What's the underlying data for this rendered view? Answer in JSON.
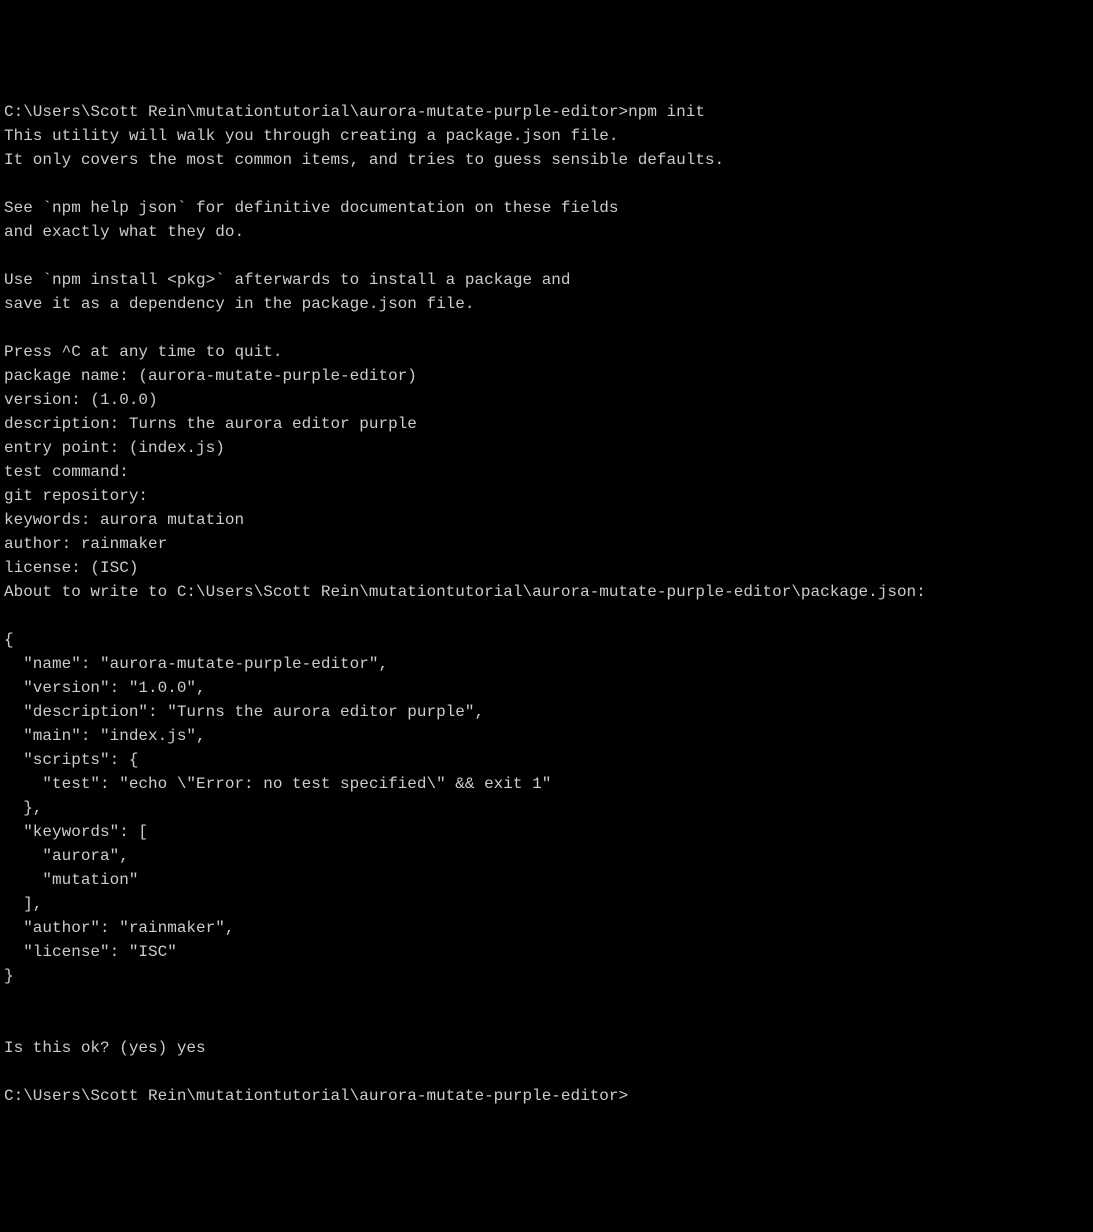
{
  "terminal": {
    "initialPrompt": "C:\\Users\\Scott Rein\\mutationtutorial\\aurora-mutate-purple-editor>",
    "initialCommand": "npm init",
    "introLine1": "This utility will walk you through creating a package.json file.",
    "introLine2": "It only covers the most common items, and tries to guess sensible defaults.",
    "helpLine1": "See `npm help json` for definitive documentation on these fields",
    "helpLine2": "and exactly what they do.",
    "installLine1": "Use `npm install <pkg>` afterwards to install a package and",
    "installLine2": "save it as a dependency in the package.json file.",
    "quitLine": "Press ^C at any time to quit.",
    "packageNameLine": "package name: (aurora-mutate-purple-editor)",
    "versionLine": "version: (1.0.0)",
    "descriptionLine": "description: Turns the aurora editor purple",
    "entryPointLine": "entry point: (index.js)",
    "testCommandLine": "test command:",
    "gitRepoLine": "git repository:",
    "keywordsLine": "keywords: aurora mutation",
    "authorLine": "author: rainmaker",
    "licenseLine": "license: (ISC)",
    "aboutToWriteLine": "About to write to C:\\Users\\Scott Rein\\mutationtutorial\\aurora-mutate-purple-editor\\package.json:",
    "jsonBlock": "{\n  \"name\": \"aurora-mutate-purple-editor\",\n  \"version\": \"1.0.0\",\n  \"description\": \"Turns the aurora editor purple\",\n  \"main\": \"index.js\",\n  \"scripts\": {\n    \"test\": \"echo \\\"Error: no test specified\\\" && exit 1\"\n  },\n  \"keywords\": [\n    \"aurora\",\n    \"mutation\"\n  ],\n  \"author\": \"rainmaker\",\n  \"license\": \"ISC\"\n}",
    "confirmLine": "Is this ok? (yes) yes",
    "finalPrompt": "C:\\Users\\Scott Rein\\mutationtutorial\\aurora-mutate-purple-editor>"
  }
}
